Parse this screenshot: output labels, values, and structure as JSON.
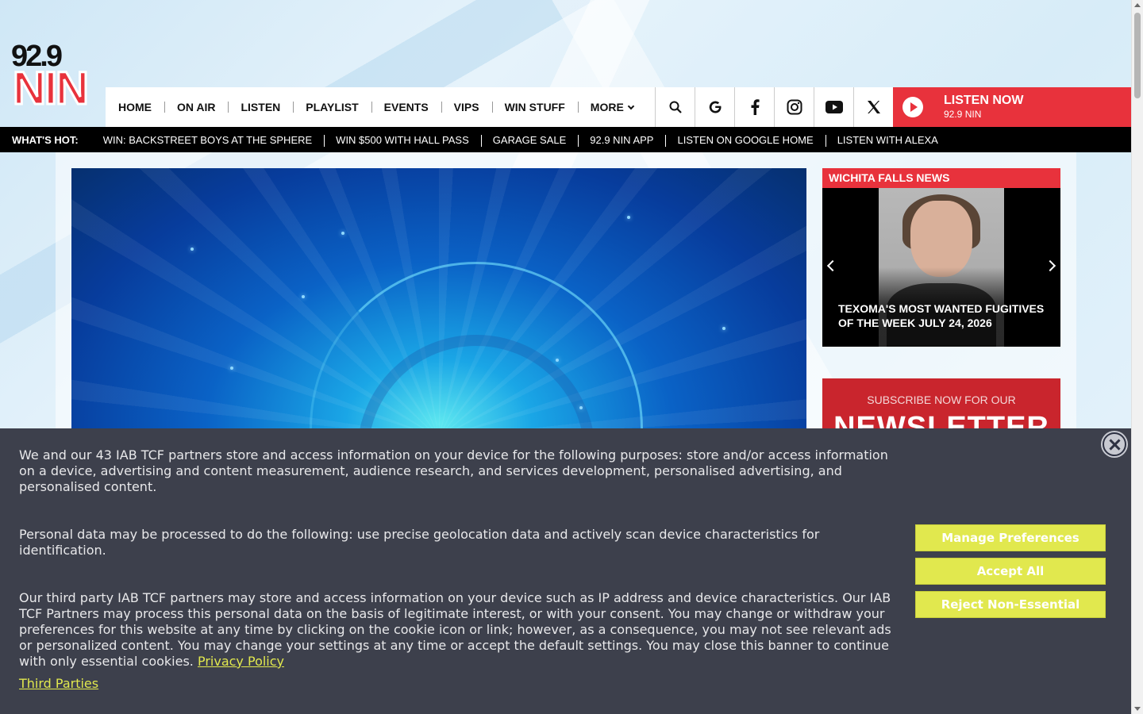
{
  "logo": {
    "number": "92.9",
    "letters": "NIN"
  },
  "nav": {
    "links": [
      "HOME",
      "ON AIR",
      "LISTEN",
      "PLAYLIST",
      "EVENTS",
      "VIPS",
      "WIN STUFF",
      "MORE"
    ],
    "icons": [
      "search-icon",
      "google-icon",
      "facebook-icon",
      "instagram-icon",
      "youtube-icon",
      "x-icon"
    ],
    "listen": {
      "title": "LISTEN NOW",
      "station": "92.9 NIN"
    }
  },
  "hotbar": {
    "label": "WHAT'S HOT:",
    "items": [
      "WIN: BACKSTREET BOYS AT THE SPHERE",
      "WIN $500 WITH HALL PASS",
      "GARAGE SALE",
      "92.9 NIN APP",
      "LISTEN ON GOOGLE HOME",
      "LISTEN WITH ALEXA"
    ]
  },
  "sidebar": {
    "news_heading": "WICHITA FALLS NEWS",
    "news_caption": "TEXOMA'S MOST WANTED FUGITIVES OF THE WEEK JULY 24, 2026",
    "newsletter_small": "SUBSCRIBE NOW FOR OUR",
    "newsletter_big": "NEWSLETTER"
  },
  "consent": {
    "p1": "We and our 43 IAB TCF partners store and access information on your device for the following purposes: store and/or access information on a device, advertising and content measurement, audience research, and services development, personalised advertising, and personalised content.",
    "p2": "Personal data may be processed to do the following: use precise geolocation data and actively scan device characteristics for identification.",
    "p3": "Our third party IAB TCF partners may store and access information on your device such as IP address and device characteristics. Our IAB TCF Partners may process this personal data on the basis of legitimate interest, or with your consent. You may change or withdraw your preferences for this website at any time by clicking on the cookie icon or link; however, as a consequence, you may not see relevant ads or personalized content. You may change your settings at any time or accept the default settings. You may close this banner to continue with only essential cookies.",
    "privacy_link": "Privacy Policy",
    "third_parties": "Third Parties",
    "buttons": {
      "manage": "Manage Preferences",
      "accept": "Accept All",
      "reject": "Reject Non-Essential"
    }
  },
  "colors": {
    "brand_red": "#e8323c",
    "consent_bg": "#3d404c",
    "consent_button": "#e1e84e"
  }
}
